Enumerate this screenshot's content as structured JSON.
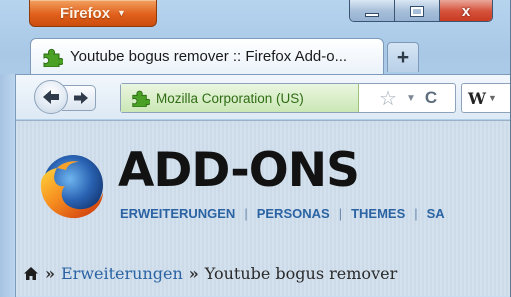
{
  "window": {
    "menu_button_label": "Firefox",
    "menu_caret": "▼",
    "controls": {
      "minimize": "minimize",
      "maximize": "maximize",
      "close": "x"
    }
  },
  "tabs": [
    {
      "title": "Youtube bogus remover :: Firefox Add-o...",
      "icon": "addon-puzzle-icon",
      "active": true
    }
  ],
  "new_tab_label": "+",
  "navbar": {
    "identity_label": "Mozilla Corporation (US)",
    "search_engine_glyph": "W",
    "dropdown_glyph": "▼",
    "reload_glyph": "C",
    "star_glyph": "☆"
  },
  "page": {
    "brand_title": "ADD-ONS",
    "subnav": [
      "ERWEITERUNGEN",
      "PERSONAS",
      "THEMES",
      "SA"
    ],
    "separator": "|",
    "breadcrumb": {
      "home_icon": "home-icon",
      "chevron": "»",
      "section": "Erweiterungen",
      "current": "Youtube bogus remover"
    }
  },
  "colors": {
    "firefox_orange": "#e0601c",
    "identity_green": "#2f6c14",
    "link_blue": "#2b63a3",
    "close_red": "#d6533c"
  }
}
